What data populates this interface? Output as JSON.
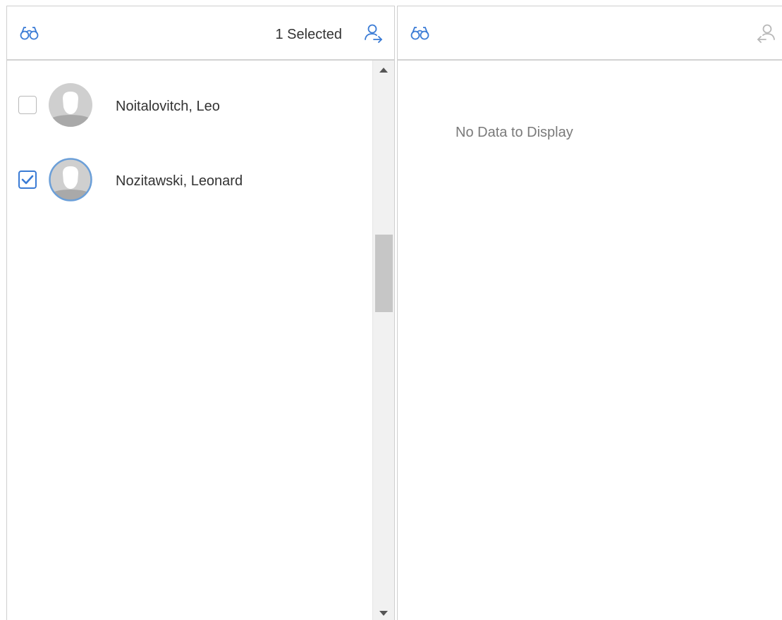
{
  "left_panel": {
    "selected_count_text": "1 Selected",
    "items": [
      {
        "name": "Noitalovitch, Leo",
        "checked": false
      },
      {
        "name": "Nozitawski, Leonard",
        "checked": true
      }
    ]
  },
  "right_panel": {
    "empty_text": "No Data to Display"
  },
  "colors": {
    "accent": "#3a7bd5",
    "disabled_icon": "#b8b8b8",
    "border": "#cfcfcf"
  },
  "icons": {
    "search": "binoculars-icon",
    "move_right": "move-user-right-icon",
    "move_left": "move-user-left-icon"
  }
}
